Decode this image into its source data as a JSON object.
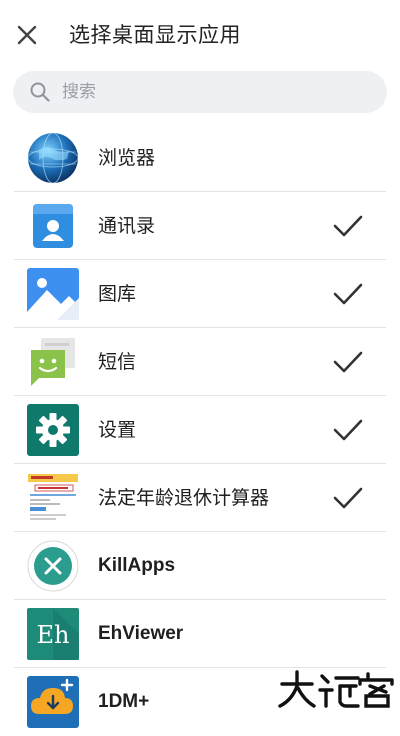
{
  "header": {
    "title": "选择桌面显示应用",
    "close_icon": "close-icon"
  },
  "search": {
    "placeholder": "搜索",
    "value": "",
    "icon": "search-icon"
  },
  "apps": [
    {
      "label": "浏览器",
      "checked": false,
      "icon": "browser-globe-icon"
    },
    {
      "label": "通讯录",
      "checked": true,
      "icon": "contacts-icon"
    },
    {
      "label": "图库",
      "checked": true,
      "icon": "gallery-icon"
    },
    {
      "label": "短信",
      "checked": true,
      "icon": "messages-icon"
    },
    {
      "label": "设置",
      "checked": true,
      "icon": "settings-gear-icon"
    },
    {
      "label": "法定年龄退休计算器",
      "checked": true,
      "icon": "retirement-calculator-icon"
    },
    {
      "label": "KillApps",
      "checked": false,
      "icon": "killapps-icon"
    },
    {
      "label": "EhViewer",
      "checked": false,
      "icon": "ehviewer-icon"
    },
    {
      "label": "1DM+",
      "checked": false,
      "icon": "download-manager-icon"
    }
  ],
  "colors": {
    "contacts": "#2f8ee0",
    "gallery": "#3d8ff0",
    "messages": "#8bc34a",
    "settings": "#0f7a6c",
    "killapps": "#2a9d8f",
    "ehviewer": "#1e8a78",
    "download": "#f5a623"
  }
}
